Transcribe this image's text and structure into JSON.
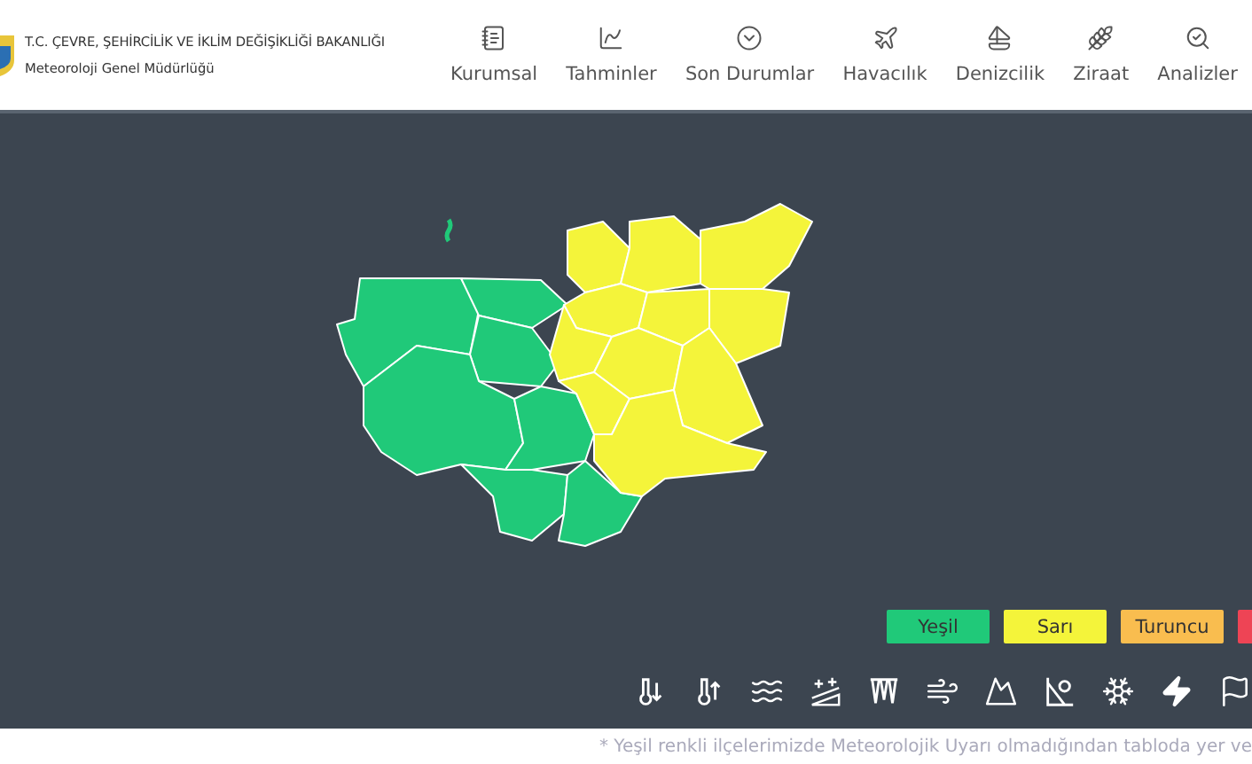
{
  "header": {
    "title": "T.C. ÇEVRE, ŞEHİRCİLİK VE İKLİM DEĞİŞİKLİĞİ BAKANLIĞI",
    "subtitle": "Meteoroloji Genel Müdürlüğü"
  },
  "nav": [
    {
      "label": "Kurumsal",
      "kind": "book"
    },
    {
      "label": "Tahminler",
      "kind": "chart"
    },
    {
      "label": "Son Durumlar",
      "kind": "circle"
    },
    {
      "label": "Havacılık",
      "kind": "plane"
    },
    {
      "label": "Denizcilik",
      "kind": "boat"
    },
    {
      "label": "Ziraat",
      "kind": "wheat"
    },
    {
      "label": "Analizler",
      "kind": "analysis"
    }
  ],
  "map": {
    "districts": [
      {
        "color": "#20c979"
      },
      {
        "color": "#20c979"
      },
      {
        "color": "#20c979"
      },
      {
        "color": "#20c979"
      },
      {
        "color": "#20c979"
      },
      {
        "color": "#20c979"
      },
      {
        "color": "#20c979"
      },
      {
        "color": "#f4f43a"
      },
      {
        "color": "#f4f43a"
      },
      {
        "color": "#f4f43a"
      },
      {
        "color": "#f4f43a"
      },
      {
        "color": "#f4f43a"
      },
      {
        "color": "#f4f43a"
      },
      {
        "color": "#f4f43a"
      },
      {
        "color": "#f4f43a"
      },
      {
        "color": "#f4f43a"
      },
      {
        "color": "#f4f43a"
      },
      {
        "color": "#f4f43a"
      }
    ]
  },
  "legend": [
    {
      "label": "Yeşil",
      "color": "#20c979"
    },
    {
      "label": "Sarı",
      "color": "#f4f43a"
    },
    {
      "label": "Turuncu",
      "color": "#f9bd4f"
    },
    {
      "color": "#ee4455"
    }
  ],
  "hazards": [
    {
      "kind": "cold"
    },
    {
      "kind": "hot"
    },
    {
      "kind": "waves"
    },
    {
      "kind": "snowfield"
    },
    {
      "kind": "icicle"
    },
    {
      "kind": "wind"
    },
    {
      "kind": "mountain"
    },
    {
      "kind": "rockfall"
    },
    {
      "kind": "snow"
    },
    {
      "kind": "lightning"
    },
    {
      "kind": "flag"
    }
  ],
  "footnote": "* Yeşil renkli ilçelerimizde Meteorolojik Uyarı olmadığından tabloda yer ve"
}
